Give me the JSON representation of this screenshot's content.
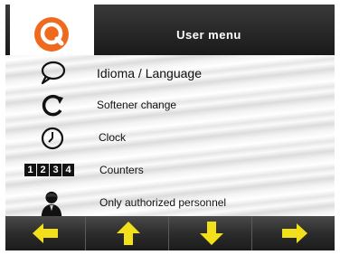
{
  "header": {
    "title": "User  menu"
  },
  "logo": {
    "icon": "search-logo-icon",
    "color": "#f06a1d"
  },
  "menu": {
    "items": [
      {
        "label": "Idioma / Language",
        "icon": "speech-bubble-icon"
      },
      {
        "label": "Softener change",
        "icon": "refresh-icon"
      },
      {
        "label": "Clock",
        "icon": "clock-icon"
      },
      {
        "label": "Counters",
        "icon": "counter-digits-icon",
        "digits": [
          "1",
          "2",
          "3",
          "4"
        ]
      },
      {
        "label": "Only authorized personnel",
        "icon": "technician-icon"
      }
    ]
  },
  "nav": {
    "buttons": [
      {
        "icon": "arrow-left-icon"
      },
      {
        "icon": "arrow-up-icon"
      },
      {
        "icon": "arrow-down-icon"
      },
      {
        "icon": "arrow-right-icon"
      }
    ],
    "arrow_color": "#f2e11a"
  }
}
